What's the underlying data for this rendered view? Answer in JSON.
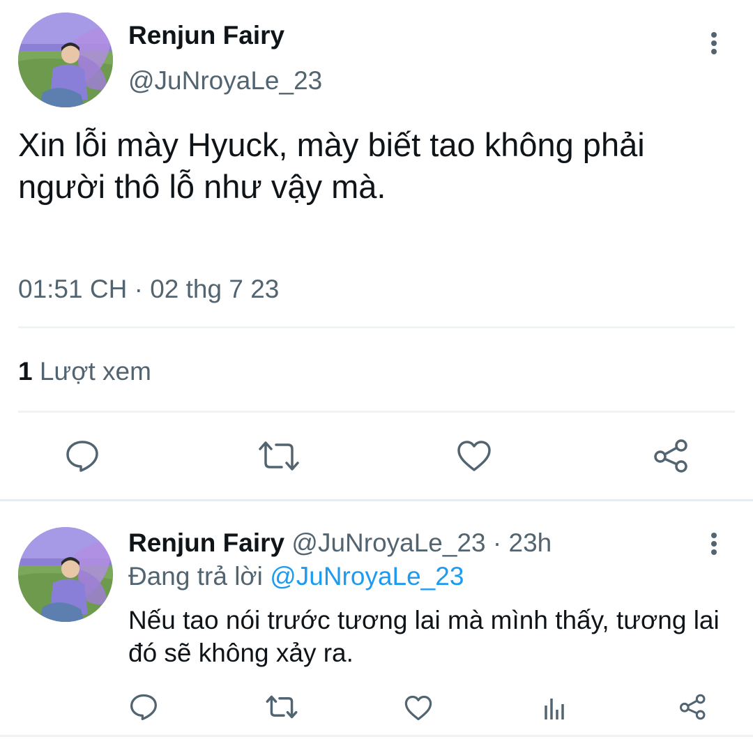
{
  "main_tweet": {
    "author_name": "Renjun Fairy",
    "handle": "@JuNroyaLe_23",
    "text": "Xin lỗi mày Hyuck, mày biết tao không phải người thô lỗ như vậy mà.",
    "timestamp": "01:51 CH · 02 thg 7 23",
    "views_count": "1",
    "views_label": "Lượt xem",
    "actions": [
      {
        "icon": "reply-icon"
      },
      {
        "icon": "retweet-icon"
      },
      {
        "icon": "like-icon"
      },
      {
        "icon": "share-icon"
      }
    ]
  },
  "reply_tweet": {
    "author_name": "Renjun Fairy",
    "handle_time": "@JuNroyaLe_23 · 23h",
    "replying_label": "Đang trả lời",
    "replying_to": "@JuNroyaLe_23",
    "text": "Nếu tao nói trước tương lai mà mình thấy, tương lai đó sẽ không xảy ra.",
    "actions": [
      {
        "icon": "reply-icon"
      },
      {
        "icon": "retweet-icon"
      },
      {
        "icon": "like-icon"
      },
      {
        "icon": "analytics-icon"
      },
      {
        "icon": "share-icon"
      }
    ]
  },
  "colors": {
    "text": "#0f1419",
    "secondary": "#536471",
    "link": "#1d9bf0",
    "divider": "#eff3f4"
  }
}
